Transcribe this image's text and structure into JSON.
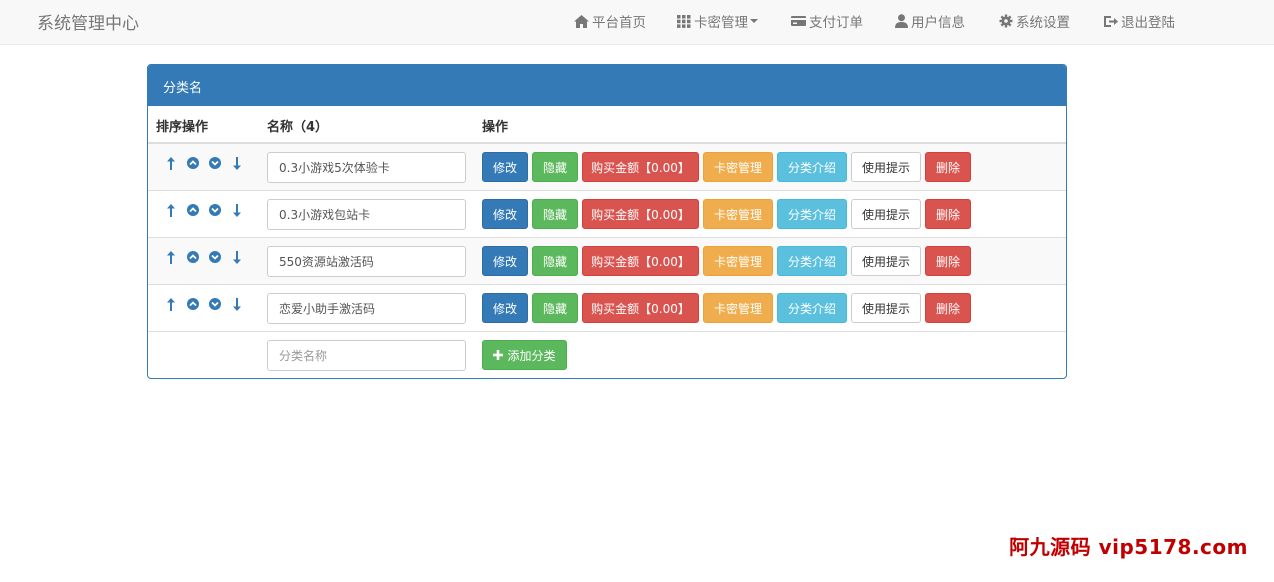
{
  "navbar": {
    "brand": "系统管理中心",
    "items": [
      {
        "label": "平台首页",
        "icon": "home-icon"
      },
      {
        "label": "卡密管理",
        "icon": "grid-icon",
        "dropdown": true
      },
      {
        "label": "支付订单",
        "icon": "credit-card-icon"
      },
      {
        "label": "用户信息",
        "icon": "user-icon"
      },
      {
        "label": "系统设置",
        "icon": "gear-icon"
      },
      {
        "label": "退出登陆",
        "icon": "logout-icon"
      }
    ]
  },
  "panel": {
    "title": "分类名",
    "columns": [
      "排序操作",
      "名称（4）",
      "操作"
    ],
    "rows": [
      {
        "name": "0.3小游戏5次体验卡"
      },
      {
        "name": "0.3小游戏包站卡"
      },
      {
        "name": "550资源站激活码"
      },
      {
        "name": "恋爱小助手激活码"
      }
    ],
    "actions": {
      "edit": "修改",
      "hide": "隐藏",
      "price": "购买金额【0.00】",
      "card_manage": "卡密管理",
      "intro": "分类介绍",
      "tip": "使用提示",
      "delete": "删除"
    },
    "new_category": {
      "placeholder": "分类名称",
      "add_label": "添加分类"
    }
  },
  "watermark": "阿九源码  vip5178.com",
  "colors": {
    "primary": "#337ab7",
    "success": "#5cb85c",
    "danger": "#d9534f",
    "warning": "#f0ad4e",
    "info": "#5bc0de"
  }
}
